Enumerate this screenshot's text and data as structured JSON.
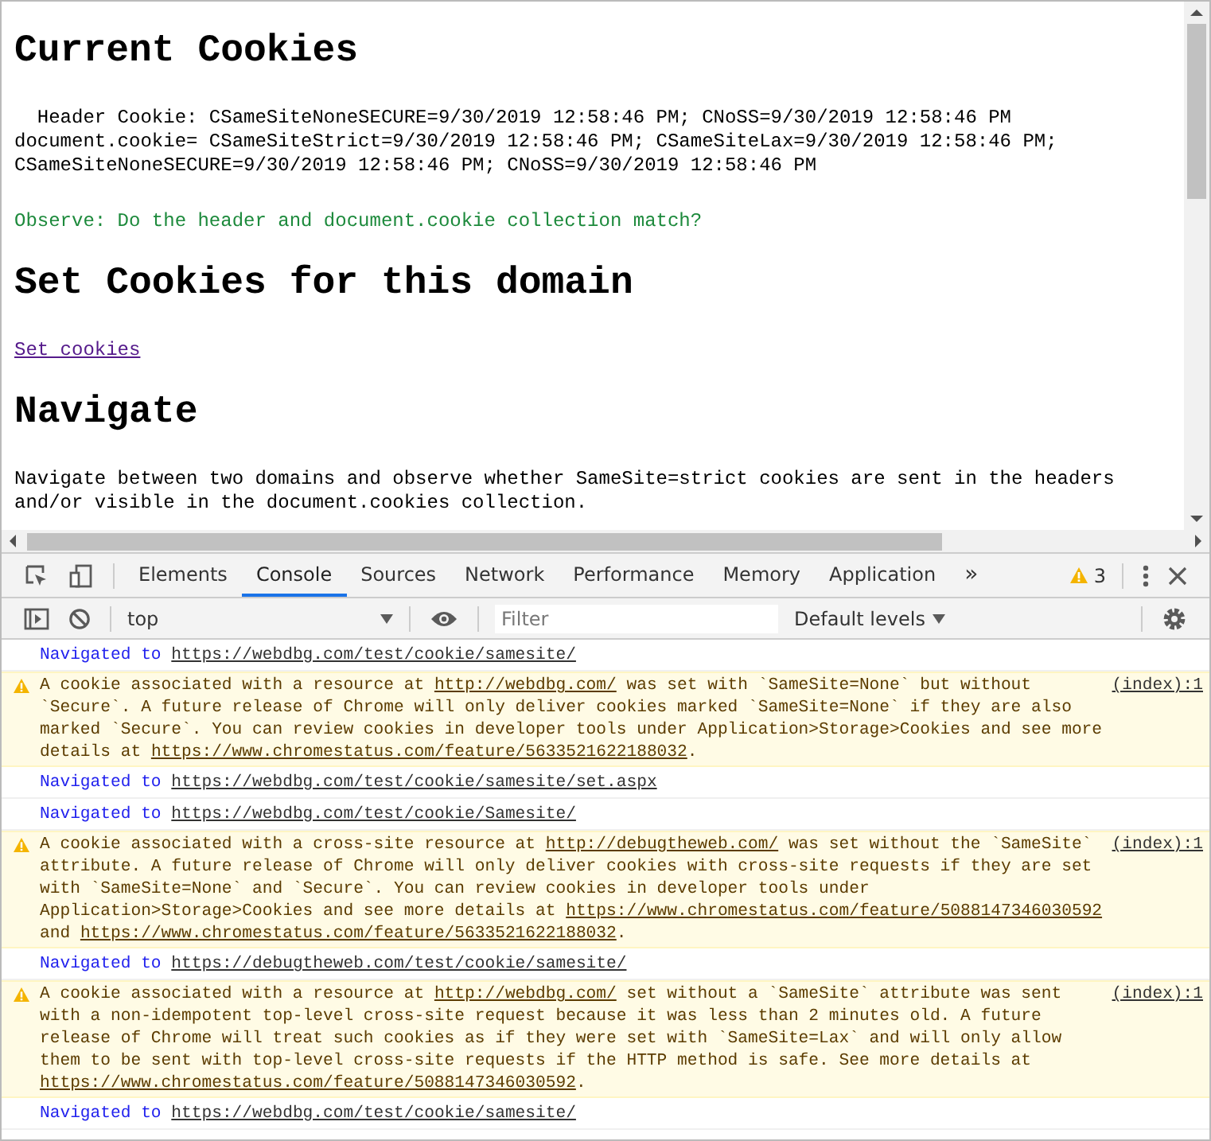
{
  "page": {
    "title": "Current Cookies",
    "cookie_lines": [
      "  Header Cookie: CSameSiteNoneSECURE=9/30/2019 12:58:46 PM; CNoSS=9/30/2019 12:58:46 PM",
      "document.cookie= CSameSiteStrict=9/30/2019 12:58:46 PM; CSameSiteLax=9/30/2019 12:58:46 PM;",
      "CSameSiteNoneSECURE=9/30/2019 12:58:46 PM; CNoSS=9/30/2019 12:58:46 PM"
    ],
    "observe": "Observe: Do the header and document.cookie collection match?",
    "set_heading": "Set Cookies for this domain",
    "set_link": "Set cookies",
    "navigate_heading": "Navigate",
    "navigate_text": "Navigate between two domains and observe whether SameSite=strict cookies are sent in the headers and/or visible in the document.cookies collection."
  },
  "devtools": {
    "tabs": [
      {
        "label": "Elements",
        "selected": false
      },
      {
        "label": "Console",
        "selected": true
      },
      {
        "label": "Sources",
        "selected": false
      },
      {
        "label": "Network",
        "selected": false
      },
      {
        "label": "Performance",
        "selected": false
      },
      {
        "label": "Memory",
        "selected": false
      },
      {
        "label": "Application",
        "selected": false
      }
    ],
    "overflow": "»",
    "warning_count": "3",
    "context": "top",
    "filter_placeholder": "Filter",
    "levels": "Default levels"
  },
  "console": [
    {
      "kind": "navigation",
      "parts": [
        {
          "text": "Navigated to "
        },
        {
          "link": "https://webdbg.com/test/cookie/samesite/"
        }
      ]
    },
    {
      "kind": "warning",
      "source": "(index):1",
      "parts": [
        {
          "text": "A cookie associated with a resource at "
        },
        {
          "link": "http://webdbg.com/"
        },
        {
          "text": " was set with `SameSite=None` but without `Secure`. A future release of Chrome will only deliver cookies marked `SameSite=None` if they are also marked `Secure`. You can review cookies in developer tools under Application>Storage>Cookies and see more details at "
        },
        {
          "link": "https://www.chromestatus.com/feature/5633521622188032"
        },
        {
          "text": "."
        }
      ]
    },
    {
      "kind": "navigation",
      "parts": [
        {
          "text": "Navigated to "
        },
        {
          "link": "https://webdbg.com/test/cookie/samesite/set.aspx"
        }
      ]
    },
    {
      "kind": "navigation",
      "parts": [
        {
          "text": "Navigated to "
        },
        {
          "link": "https://webdbg.com/test/cookie/Samesite/"
        }
      ]
    },
    {
      "kind": "warning",
      "source": "(index):1",
      "parts": [
        {
          "text": "A cookie associated with a cross-site resource at "
        },
        {
          "link": "http://debugtheweb.com/"
        },
        {
          "text": " was set without the `SameSite` attribute. A future release of Chrome will only deliver cookies with cross-site requests if they are set with `SameSite=None` and `Secure`. You can review cookies in developer tools under Application>Storage>Cookies and see more details at "
        },
        {
          "link": "https://www.chromestatus.com/feature/5088147346030592"
        },
        {
          "text": " and "
        },
        {
          "link": "https://www.chromestatus.com/feature/5633521622188032"
        },
        {
          "text": "."
        }
      ]
    },
    {
      "kind": "navigation",
      "parts": [
        {
          "text": "Navigated to "
        },
        {
          "link": "https://debugtheweb.com/test/cookie/samesite/"
        }
      ]
    },
    {
      "kind": "warning",
      "source": "(index):1",
      "parts": [
        {
          "text": "A cookie associated with a resource at "
        },
        {
          "link": "http://webdbg.com/"
        },
        {
          "text": " set without a `SameSite` attribute was sent with a non-idempotent top-level cross-site request because it was less than 2 minutes old. A future release of Chrome will treat such cookies as if they were set with `SameSite=Lax` and will only allow them to be sent with top-level cross-site requests if the HTTP method is safe. See more details at "
        },
        {
          "link": "https://www.chromestatus.com/feature/5088147346030592"
        },
        {
          "text": "."
        }
      ]
    },
    {
      "kind": "navigation",
      "parts": [
        {
          "text": "Navigated to "
        },
        {
          "link": "https://webdbg.com/test/cookie/samesite/"
        }
      ]
    }
  ]
}
